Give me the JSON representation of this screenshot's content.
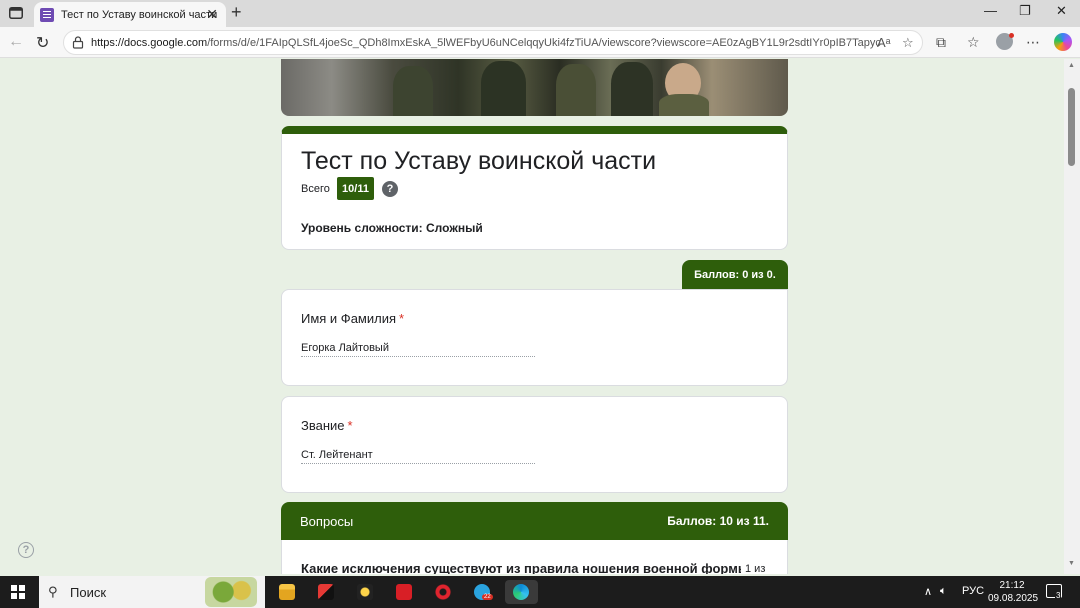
{
  "browser": {
    "tab_title": "Тест по Уставу воинской части",
    "url_domain": "https://docs.google.com",
    "url_path": "/forms/d/e/1FAIpQLSfL4joeSc_QDh8ImxEskA_5lWEFbyU6uNCelqqyUki4fzTiUA/viewscore?viewscore=AE0zAgBY1L9r2sdtIYr0pIB7Tapyc...",
    "window_controls": {
      "minimize": "—",
      "maximize": "❐",
      "close": "✕"
    }
  },
  "form": {
    "title": "Тест по Уставу воинской части",
    "total_label": "Всего",
    "total_score": "10/11",
    "help_icon": "?",
    "difficulty": "Уровень сложности: Сложный",
    "points_tab": "Баллов: 0 из 0.",
    "questions": [
      {
        "label": "Имя и Фамилия",
        "required": "*",
        "answer": "Егорка Лайтовый"
      },
      {
        "label": "Звание",
        "required": "*",
        "answer": "Ст. Лейтенант"
      }
    ],
    "section": {
      "title": "Вопросы",
      "score": "Баллов: 10 из 11.",
      "first_question": "Какие исключения существуют из правила ношения военной формы на",
      "first_question_points": "1 из"
    },
    "page_help": "?"
  },
  "taskbar": {
    "search_label": "Поиск",
    "language": "РУС",
    "time": "21:12",
    "date": "09.08.2025",
    "notifications": "3",
    "telegram_badge": "22"
  },
  "colors": {
    "accent": "#2e5e0b",
    "page_bg": "#e8f0e4",
    "required": "#d93025"
  }
}
